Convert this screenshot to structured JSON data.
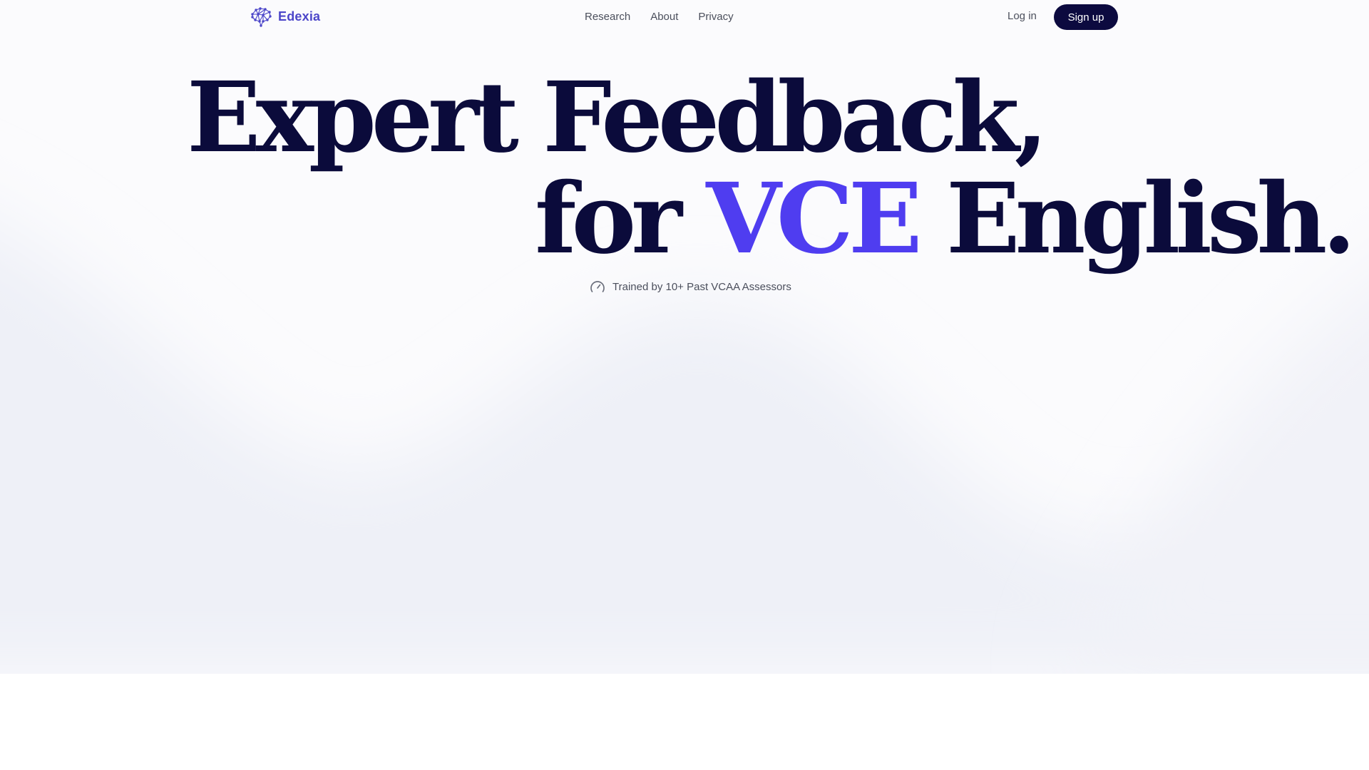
{
  "nav": {
    "brand": "Edexia",
    "links": [
      {
        "label": "Research"
      },
      {
        "label": "About"
      },
      {
        "label": "Privacy"
      }
    ],
    "login_label": "Log in",
    "signup_label": "Sign up"
  },
  "hero": {
    "line1": "Expert Feedback,",
    "line2_prefix": "for ",
    "line2_accent": "VCE",
    "line2_suffix": " English.",
    "badge_text": "Trained by 10+ Past VCAA Assessors"
  },
  "colors": {
    "brand": "#4c46c9",
    "accent": "#4f3df0",
    "headline": "#0b0b3b",
    "button_bg": "#0c0a3f",
    "hero_bg": "#fbfbfd",
    "wave": "#eef0f7"
  },
  "icons": {
    "logo": "brain-network-icon",
    "badge": "gauge-icon"
  }
}
